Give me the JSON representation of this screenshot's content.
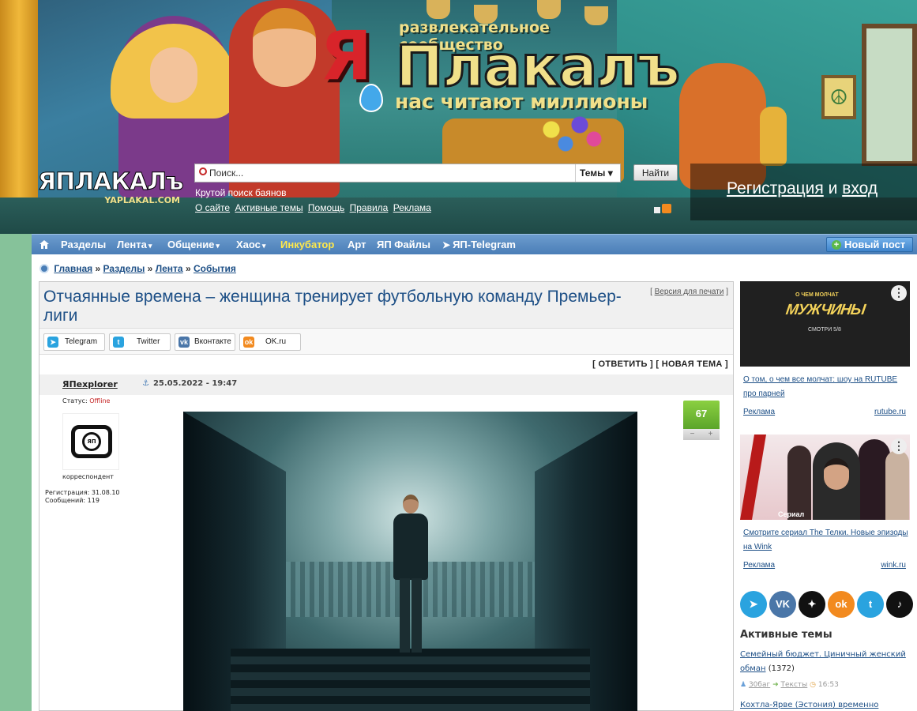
{
  "header": {
    "tagline_top": "развлекательное сообщество",
    "logo_ya": "Я",
    "logo_plakal": "Плакалъ",
    "tagline_bottom": "нас читают миллионы",
    "small_logo_text": "ЯПЛАКАЛъ",
    "small_logo_sub": "YAPLAKAL.COM",
    "search_placeholder": "Поиск...",
    "search_scope": "Темы",
    "search_button": "Найти",
    "search_hint": "Крутой поиск баянов",
    "links": [
      "О сайте",
      "Активные темы",
      "Помощь",
      "Правила",
      "Реклама"
    ],
    "auth_register": "Регистрация",
    "auth_and": "и",
    "auth_login": "вход"
  },
  "nav": {
    "items": [
      "Разделы",
      "Лента",
      "Общение",
      "Хаос",
      "Инкубатор",
      "Арт",
      "ЯП Файлы",
      "ЯП-Telegram"
    ],
    "new_post": "Новый пост"
  },
  "breadcrumb": [
    "Главная",
    "Разделы",
    "Лента",
    "События"
  ],
  "breadcrumb_sep": "»",
  "topic": {
    "title": "Отчаянные времена – женщина тренирует футбольную команду Премьер-лиги",
    "print_link": "Версия для печати",
    "share": [
      "Telegram",
      "Twitter",
      "Вконтакте",
      "OK.ru"
    ],
    "reply": "ОТВЕТИТЬ",
    "new_topic": "НОВАЯ ТЕМА"
  },
  "post": {
    "author": "ЯПexplorer",
    "date": "25.05.2022 - 19:47",
    "status_label": "Статус:",
    "status_value": "Offline",
    "avatar_label": "ЯП",
    "rank": "корреспондент",
    "reg_label": "Регистрация: 31.08.10",
    "msgs_label": "Сообщений: 119",
    "rating": "67",
    "minus": "−",
    "plus": "+"
  },
  "sidebar": {
    "ad1": {
      "img_tag": "О ЧЕМ МОЛЧАТ",
      "img_big": "МУЖЧИНЫ",
      "img_small": "СМОТРИ 5/8",
      "text": "О том, о чем все молчат: шоу на RUTUBE про парней",
      "label": "Реклама",
      "domain": "rutube.ru"
    },
    "ad2": {
      "img_label": "Сериал",
      "text": "Смотрите сериал The Телки. Новые эпизоды на Wink",
      "label": "Реклама",
      "domain": "wink.ru"
    },
    "social": [
      {
        "name": "telegram",
        "glyph": "➤",
        "color": "#2aa3df"
      },
      {
        "name": "vk",
        "glyph": "VK",
        "color": "#4a76a8"
      },
      {
        "name": "zen",
        "glyph": "✦",
        "color": "#111111"
      },
      {
        "name": "ok",
        "glyph": "ok",
        "color": "#f28a1f"
      },
      {
        "name": "twitter",
        "glyph": "t",
        "color": "#2aa3df"
      },
      {
        "name": "tiktok",
        "glyph": "♪",
        "color": "#111111"
      }
    ],
    "active_title": "Активные темы",
    "active_topics": [
      {
        "title": "Семейный бюджет. Циничный женский обман",
        "count": "(1372)",
        "user": "30баг",
        "section": "Тексты",
        "time": "16:53"
      },
      {
        "title": "Кохтла-Ярве (Эстония) временно"
      }
    ]
  },
  "icons": {
    "home": "home-icon",
    "caret": "▾"
  }
}
